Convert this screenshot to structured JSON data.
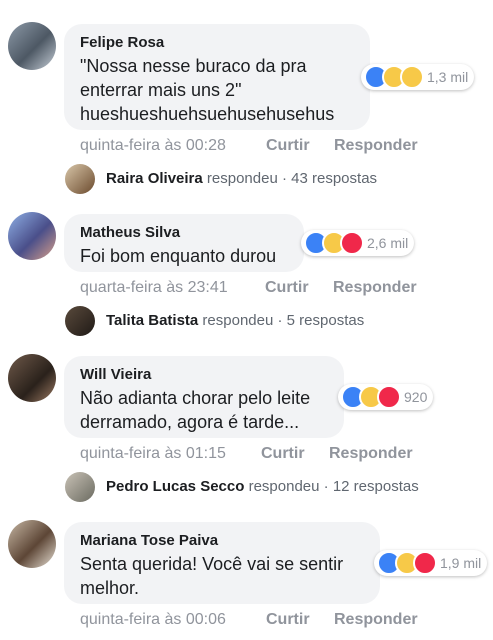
{
  "comments": [
    {
      "author": "Felipe Rosa",
      "text": "\"Nossa nesse buraco da pra\nenterrar mais uns 2\"\nhueshueshuehsuehusehusehus",
      "time": "quinta-feira às 00:28",
      "like_label": "Curtir",
      "reply_label": "Responder",
      "reaction_count": "1,3 mil",
      "reply_author": "Raira Oliveira",
      "reply_verb": "respondeu",
      "reply_count": "· 43 respostas"
    },
    {
      "author": "Matheus Silva",
      "text": "Foi bom enquanto durou",
      "time": "quarta-feira às 23:41",
      "like_label": "Curtir",
      "reply_label": "Responder",
      "reaction_count": "2,6 mil",
      "reply_author": "Talita Batista",
      "reply_verb": "respondeu",
      "reply_count": "· 5 respostas"
    },
    {
      "author": "Will Vieira",
      "text": "Não adianta chorar pelo leite\nderramado, agora é tarde...",
      "time": "quinta-feira às 01:15",
      "like_label": "Curtir",
      "reply_label": "Responder",
      "reaction_count": "920",
      "reply_author": "Pedro Lucas Secco",
      "reply_verb": "respondeu",
      "reply_count": "· 12 respostas"
    },
    {
      "author": "Mariana Tose Paiva",
      "text": "Senta querida! Você vai se sentir\nmelhor.",
      "time": "quinta-feira às 00:06",
      "like_label": "Curtir",
      "reply_label": "Responder",
      "reaction_count": "1,9 mil"
    }
  ],
  "icons": {
    "like": "like-reaction-icon",
    "haha": "haha-reaction-icon",
    "wow": "wow-reaction-icon",
    "love": "love-reaction-icon"
  },
  "colors": {
    "bubble": "#f2f3f5",
    "like_blue": "#3b82f6",
    "love_red": "#f0284a",
    "emoji_yellow": "#f7c948",
    "meta_gray": "#90949c"
  }
}
